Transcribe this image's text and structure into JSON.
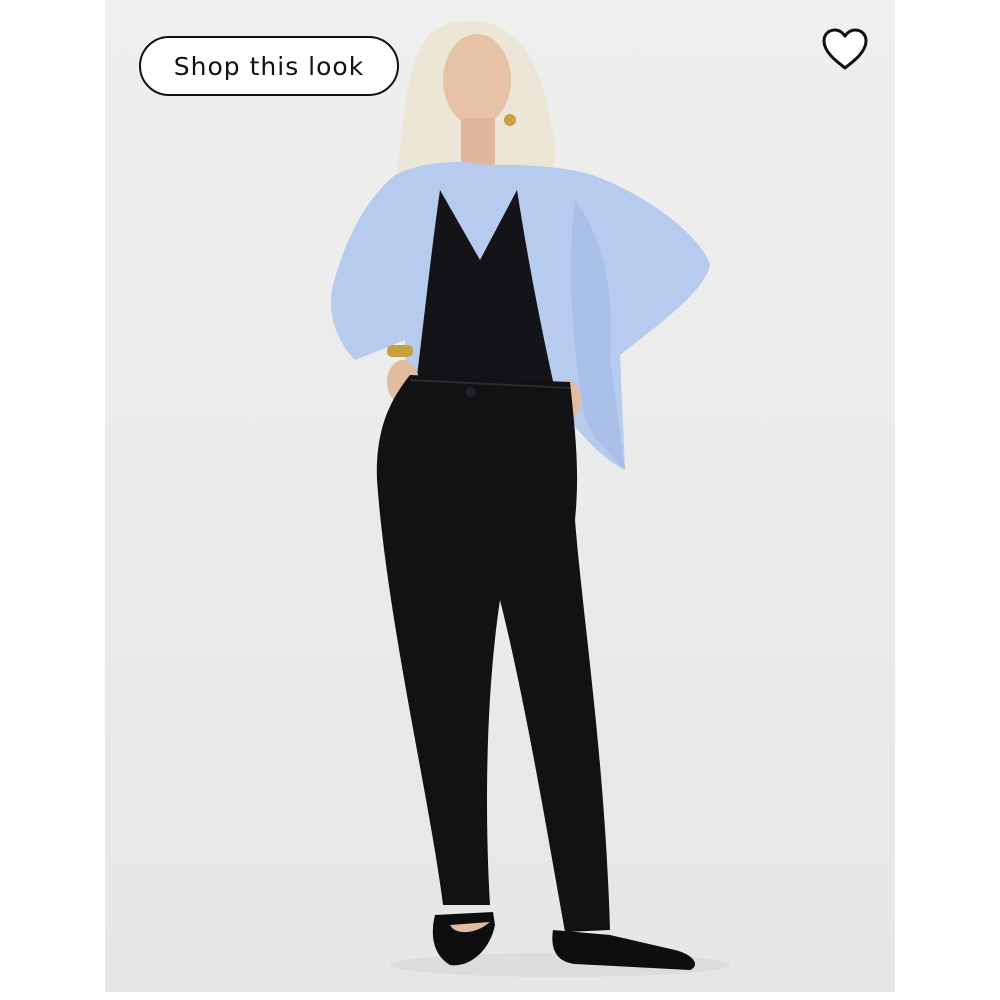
{
  "shop_button": {
    "label": "Shop this look"
  },
  "favorite": {
    "icon": "heart-outline-icon",
    "state": "not-favorited"
  },
  "product_image": {
    "subject": "model-full-length",
    "colors": {
      "background": "#ececec",
      "shirt": "#b7cbef",
      "top": "#141418",
      "pants": "#121214",
      "hair": "#ece6d6",
      "skin": "#e6c2a6"
    }
  }
}
